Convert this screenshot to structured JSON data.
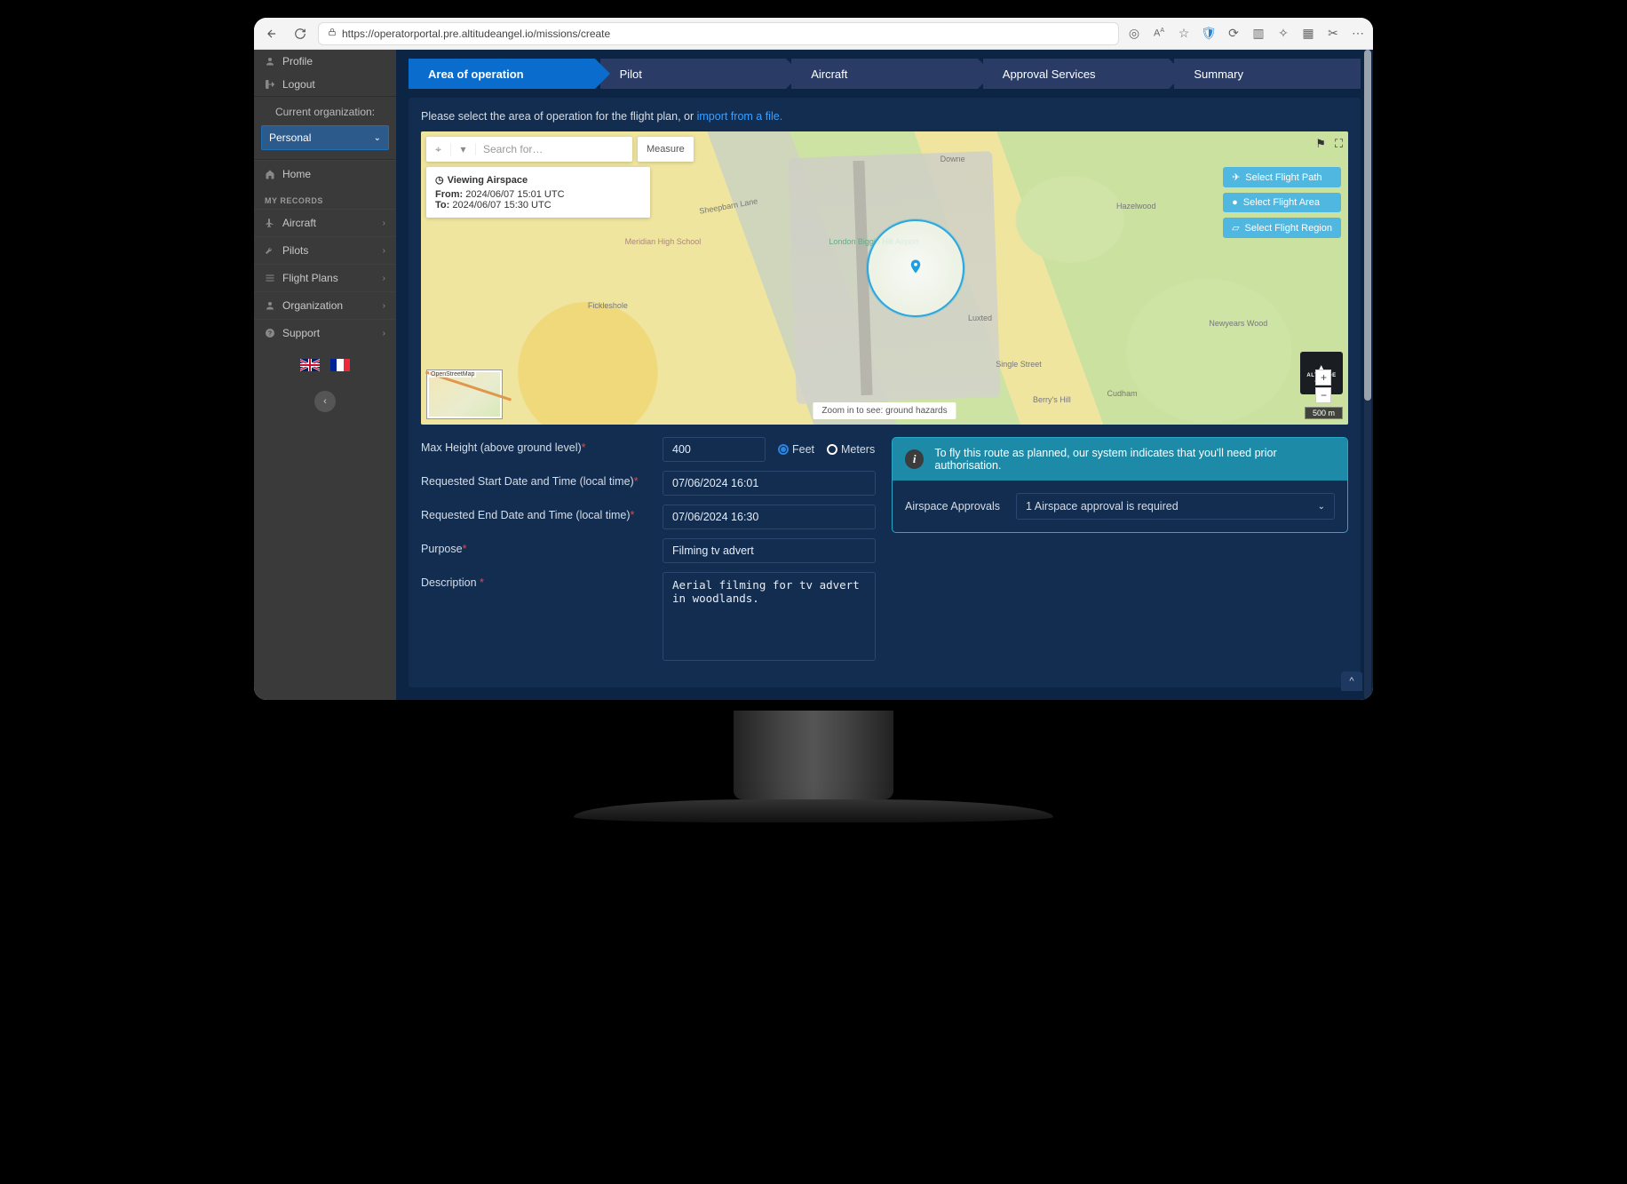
{
  "browser": {
    "url": "https://operatorportal.pre.altitudeangel.io/missions/create"
  },
  "sidebar": {
    "profile": "Profile",
    "logout": "Logout",
    "org_header": "Current organization:",
    "org_value": "Personal",
    "home": "Home",
    "section_label": "MY RECORDS",
    "items": [
      {
        "label": "Aircraft"
      },
      {
        "label": "Pilots"
      },
      {
        "label": "Flight Plans"
      },
      {
        "label": "Organization"
      },
      {
        "label": "Support"
      }
    ]
  },
  "wizard": [
    "Area of operation",
    "Pilot",
    "Aircraft",
    "Approval Services",
    "Summary"
  ],
  "prompt": {
    "text": "Please select the area of operation for the flight plan, or ",
    "link": "import from a file."
  },
  "map": {
    "search_placeholder": "Search for…",
    "measure": "Measure",
    "airspace_title": "Viewing Airspace",
    "from_label": "From:",
    "from_value": "2024/06/07 15:01 UTC",
    "to_label": "To:",
    "to_value": "2024/06/07 15:30 UTC",
    "hint": "Zoom in to see: ground hazards",
    "brand": "ALTITUDE",
    "brand_sub": "ANGEL",
    "scale": "500 m",
    "minimap_label": "OpenStreetMap",
    "actions": [
      "Select Flight Path",
      "Select Flight Area",
      "Select Flight Region"
    ],
    "places": [
      "Downe",
      "Luxted",
      "Single Street",
      "Cudham",
      "Hazelwood",
      "Newyears Wood",
      "Berry's Hill",
      "Biggin Hill",
      "London Biggin Hill Airport",
      "Meridian High School",
      "Sheepbarn Lane",
      "Fickleshole"
    ]
  },
  "form": {
    "labels": {
      "max_height": "Max Height (above ground level)",
      "start": "Requested Start Date and Time (local time)",
      "end": "Requested End Date and Time (local time)",
      "purpose": "Purpose",
      "description": "Description"
    },
    "values": {
      "max_height": "400",
      "start": "07/06/2024 16:01",
      "end": "07/06/2024 16:30",
      "purpose": "Filming tv advert",
      "description": "Aerial filming for tv advert in woodlands."
    },
    "units": {
      "feet": "Feet",
      "meters": "Meters"
    }
  },
  "info": {
    "message": "To fly this route as planned, our system indicates that you'll need prior authorisation.",
    "appr_label": "Airspace Approvals",
    "appr_value": "1 Airspace approval is required"
  }
}
